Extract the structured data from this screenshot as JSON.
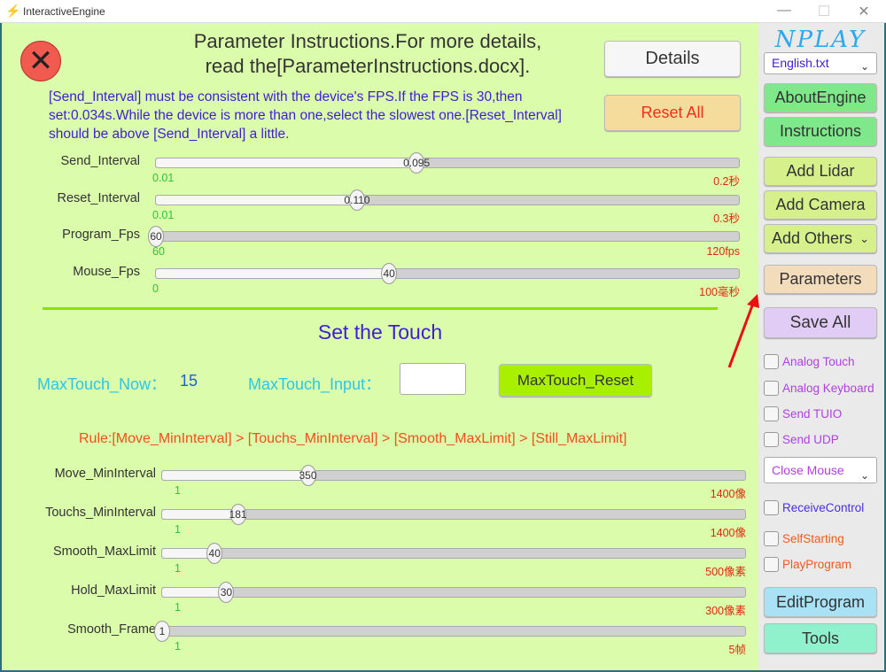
{
  "window": {
    "title": "InteractiveEngine",
    "minimize": "—",
    "maximize": "☐",
    "close": "✕"
  },
  "header": {
    "close_glyph": "✕",
    "heading_line1": "Parameter Instructions.For more details,",
    "heading_line2": "read the[ParameterInstructions.docx].",
    "instructions": "[Send_Interval] must be consistent with the device's FPS.If the FPS is 30,then set:0.034s.While the device is more than one,select the slowest one.[Reset_Interval] should be above [Send_Interval] a little.",
    "details_label": "Details",
    "reset_all_label": "Reset All"
  },
  "sliders_top": [
    {
      "label": "Send_Interval",
      "value": "0.095",
      "min": "0.01",
      "max": "0.2秒",
      "fraction": 0.447
    },
    {
      "label": "Reset_Interval",
      "value": "0.110",
      "min": "0.01",
      "max": "0.3秒",
      "fraction": 0.345
    },
    {
      "label": "Program_Fps",
      "value": "60",
      "min": "60",
      "max": "120fps",
      "fraction": 0
    },
    {
      "label": "Mouse_Fps",
      "value": "40",
      "min": "0",
      "max": "100毫秒",
      "fraction": 0.4
    }
  ],
  "touch": {
    "title": "Set the Touch",
    "now_label": "MaxTouch_Now：",
    "now_value": "15",
    "input_label": "MaxTouch_Input：",
    "input_value": "",
    "reset_label": "MaxTouch_Reset",
    "rule": "Rule:[Move_MinInterval] > [Touchs_MinInterval] > [Smooth_MaxLimit] > [Still_MaxLimit]"
  },
  "sliders_bottom": [
    {
      "label": "Move_MinInterval",
      "value": "350",
      "min": "1",
      "max": "1400像",
      "fraction": 0.25
    },
    {
      "label": "Touchs_MinInterval",
      "value": "181",
      "min": "1",
      "max": "1400像",
      "fraction": 0.13
    },
    {
      "label": "Smooth_MaxLimit",
      "value": "40",
      "min": "1",
      "max": "500像素",
      "fraction": 0.09
    },
    {
      "label": "Hold_MaxLimit",
      "value": "30",
      "min": "1",
      "max": "300像素",
      "fraction": 0.11
    },
    {
      "label": "Smooth_Frame",
      "value": "1",
      "min": "1",
      "max": "5帧",
      "fraction": 0
    }
  ],
  "sidebar": {
    "logo": "NPLAY",
    "language": "English.txt",
    "about": "AboutEngine",
    "instructions": "Instructions",
    "add_lidar": "Add Lidar",
    "add_camera": "Add Camera",
    "add_others": "Add Others",
    "parameters": "Parameters",
    "save_all": "Save All",
    "checks": [
      "Analog Touch",
      "Analog Keyboard",
      "Send TUIO",
      "Send UDP"
    ],
    "mouse_select": "Close Mouse",
    "receive": "ReceiveControl",
    "self_starting": "SelfStarting",
    "play_program": "PlayProgram",
    "edit_program": "EditProgram",
    "tools": "Tools"
  },
  "colors": {
    "bg": "#dafcab",
    "accent_green": "#a8f000",
    "red_arrow": "#e81010"
  }
}
